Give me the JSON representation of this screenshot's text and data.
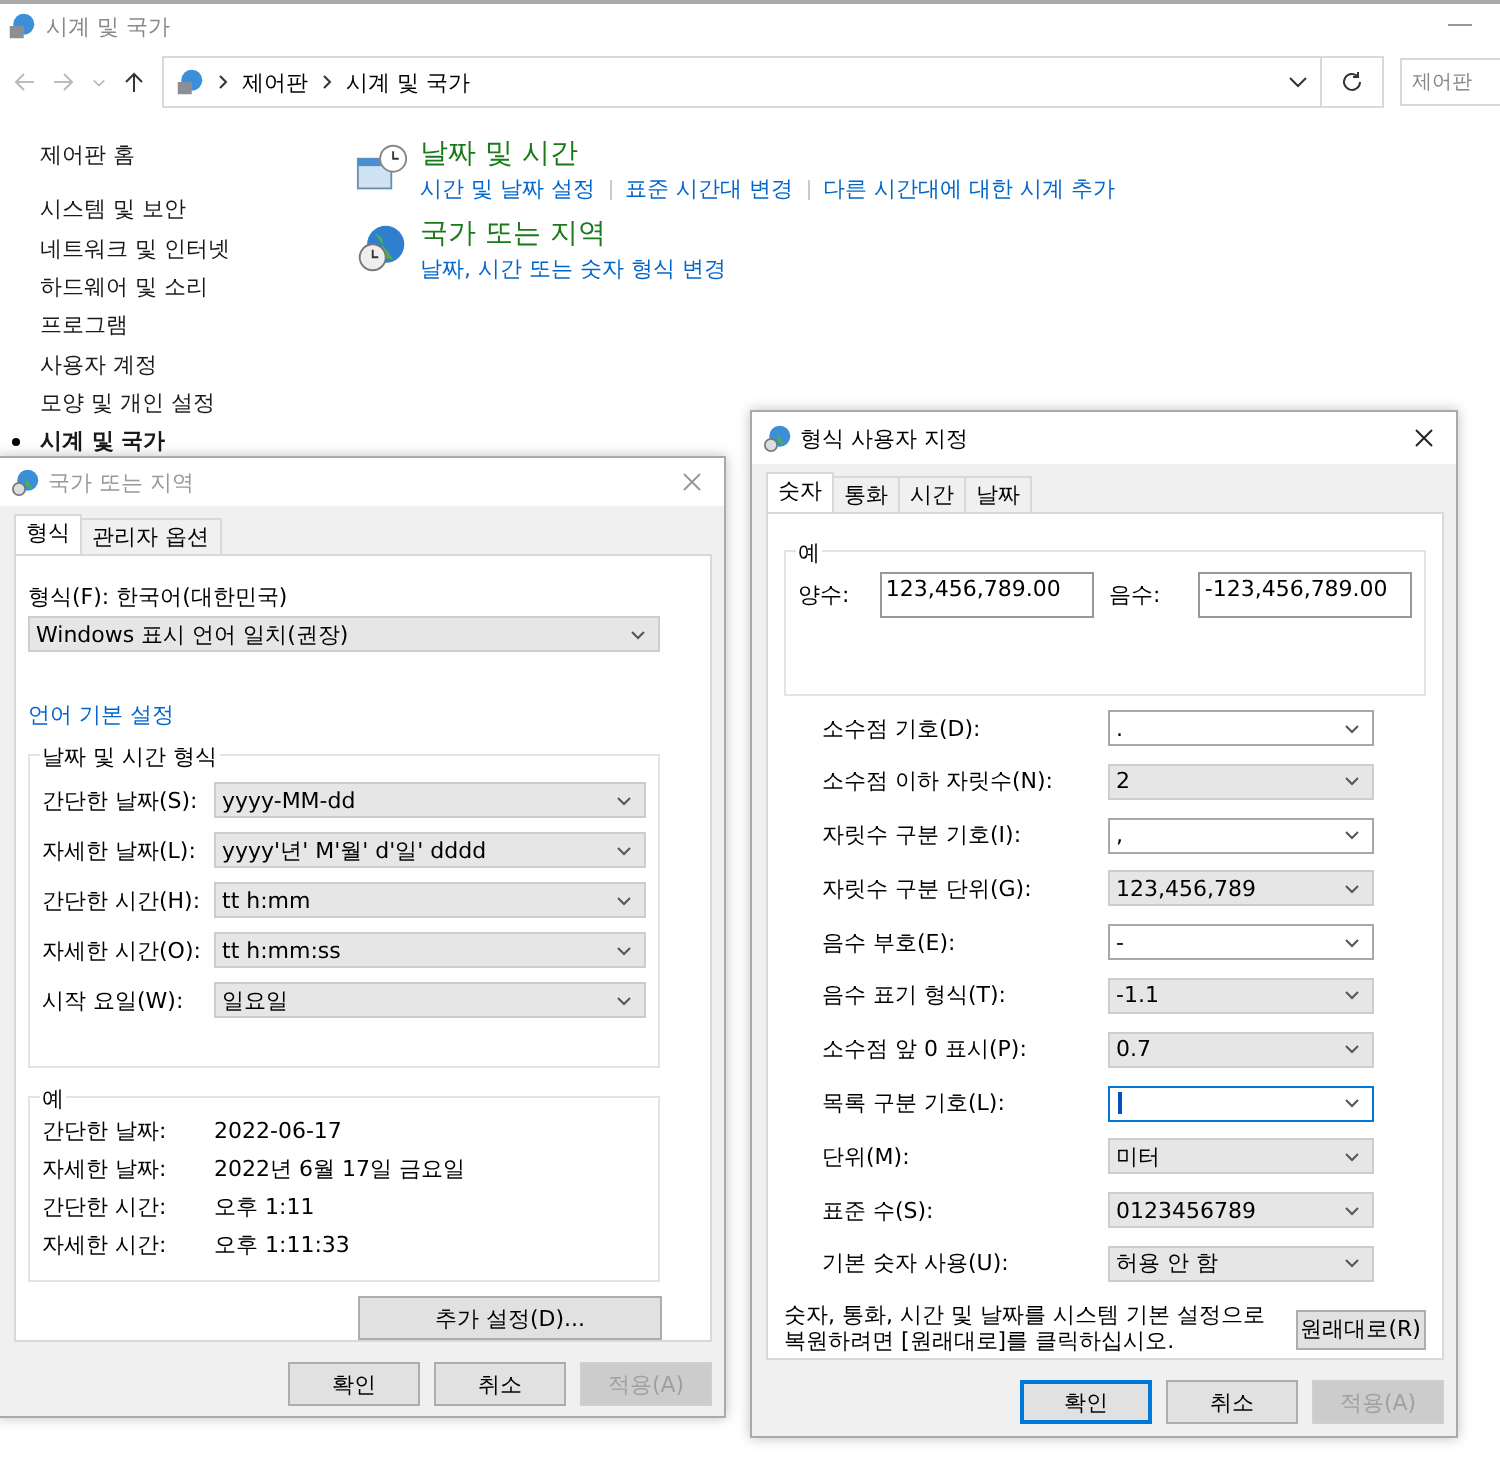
{
  "window": {
    "title": "시계 및 국가"
  },
  "address": {
    "path": [
      "제어판",
      "시계 및 국가"
    ],
    "search_placeholder": "제어판"
  },
  "sidebar": {
    "items": [
      {
        "label": "제어판 홈",
        "selected": false
      },
      {
        "label": "시스템 및 보안",
        "selected": false
      },
      {
        "label": "네트워크 및 인터넷",
        "selected": false
      },
      {
        "label": "하드웨어 및 소리",
        "selected": false
      },
      {
        "label": "프로그램",
        "selected": false
      },
      {
        "label": "사용자 계정",
        "selected": false
      },
      {
        "label": "모양 및 개인 설정",
        "selected": false
      },
      {
        "label": "시계 및 국가",
        "selected": true
      }
    ]
  },
  "categories": [
    {
      "title": "날짜 및 시간",
      "kind": "calendar",
      "links": [
        "시간 및 날짜 설정",
        "표준 시간대 변경",
        "다른 시간대에 대한 시계 추가"
      ]
    },
    {
      "title": "국가 또는 지역",
      "kind": "globe",
      "links": [
        "날짜, 시간 또는 숫자 형식 변경"
      ]
    }
  ],
  "region_dialog": {
    "title": "국가 또는 지역",
    "tabs": [
      {
        "label": "형식",
        "selected": true
      },
      {
        "label": "관리자 옵션",
        "selected": false
      }
    ],
    "format_label": "형식(F): 한국어(대한민국)",
    "format_combo": "Windows 표시 언어 일치(권장)",
    "language_link": "언어 기본 설정",
    "datetime_group": {
      "title": "날짜 및 시간 형식",
      "rows": [
        {
          "label": "간단한 날짜(S):",
          "value": "yyyy-MM-dd"
        },
        {
          "label": "자세한 날짜(L):",
          "value": "yyyy'년' M'월' d'일' dddd"
        },
        {
          "label": "간단한 시간(H):",
          "value": "tt h:mm"
        },
        {
          "label": "자세한 시간(O):",
          "value": "tt h:mm:ss"
        },
        {
          "label": "시작 요일(W):",
          "value": "일요일"
        }
      ]
    },
    "example_group": {
      "title": "예",
      "rows": [
        {
          "label": "간단한 날짜:",
          "value": "2022-06-17"
        },
        {
          "label": "자세한 날짜:",
          "value": "2022년 6월 17일 금요일"
        },
        {
          "label": "간단한 시간:",
          "value": "오후 1:11"
        },
        {
          "label": "자세한 시간:",
          "value": "오후 1:11:33"
        }
      ]
    },
    "more_button": "추가 설정(D)...",
    "buttons": [
      {
        "label": "확인",
        "disabled": false,
        "default": false
      },
      {
        "label": "취소",
        "disabled": false,
        "default": false
      },
      {
        "label": "적용(A)",
        "disabled": true,
        "default": false
      }
    ]
  },
  "custom_dialog": {
    "title": "형식 사용자 지정",
    "tabs": [
      {
        "label": "숫자",
        "selected": true
      },
      {
        "label": "통화",
        "selected": false
      },
      {
        "label": "시간",
        "selected": false
      },
      {
        "label": "날짜",
        "selected": false
      }
    ],
    "example": {
      "title": "예",
      "positive_label": "양수:",
      "positive_value": "123,456,789.00",
      "negative_label": "음수:",
      "negative_value": "-123,456,789.00"
    },
    "rows": [
      {
        "label": "소수점 기호(D):",
        "value": ".",
        "kind": "editable",
        "focused": false
      },
      {
        "label": "소수점 이하 자릿수(N):",
        "value": "2",
        "kind": "list",
        "focused": false
      },
      {
        "label": "자릿수 구분 기호(I):",
        "value": ",",
        "kind": "editable",
        "focused": false
      },
      {
        "label": "자릿수 구분 단위(G):",
        "value": "123,456,789",
        "kind": "list",
        "focused": false
      },
      {
        "label": "음수 부호(E):",
        "value": "-",
        "kind": "editable",
        "focused": false
      },
      {
        "label": "음수 표기 형식(T):",
        "value": "-1.1",
        "kind": "list",
        "focused": false
      },
      {
        "label": "소수점 앞 0 표시(P):",
        "value": "0.7",
        "kind": "list",
        "focused": false
      },
      {
        "label": "목록 구분 기호(L):",
        "kind": "editable",
        "focused": true
      },
      {
        "label": "단위(M):",
        "value": "미터",
        "kind": "list",
        "focused": false
      },
      {
        "label": "표준 수(S):",
        "value": "0123456789",
        "kind": "list",
        "focused": false
      },
      {
        "label": "기본 숫자 사용(U):",
        "value": "허용 안 함",
        "kind": "list",
        "focused": false
      }
    ],
    "reset_note": "숫자, 통화, 시간 및 날짜를 시스템 기본 설정으로 복원하려면 [원래대로]를 클릭하십시오.",
    "reset_button": "원래대로(R)",
    "buttons": [
      {
        "label": "확인",
        "disabled": false,
        "default": true
      },
      {
        "label": "취소",
        "disabled": false,
        "default": false
      },
      {
        "label": "적용(A)",
        "disabled": true,
        "default": false
      }
    ]
  }
}
